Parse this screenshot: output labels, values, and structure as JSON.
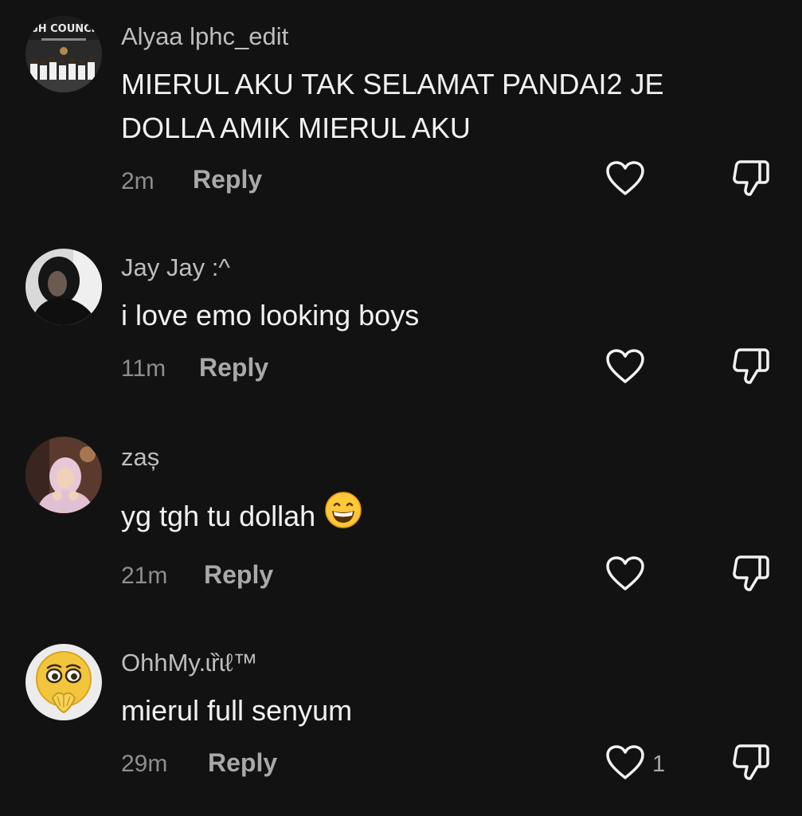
{
  "comments": [
    {
      "username": "Alyaa lphc_edit",
      "avatar_banner": "IGH COUNCIL",
      "text_line1": "MIERUL AKU TAK SELAMAT PANDAI2 JE",
      "text_line2": "DOLLA AMIK MIERUL AKU",
      "time": "2m",
      "reply_label": "Reply",
      "like_icon": "heart-outline-icon",
      "dislike_icon": "thumbs-down-icon"
    },
    {
      "username": "Jay Jay :^",
      "text": "i love emo looking boys",
      "time": "11m",
      "reply_label": "Reply",
      "like_icon": "heart-outline-icon",
      "dislike_icon": "thumbs-down-icon"
    },
    {
      "username": "zaș",
      "text": "yg tgh tu dollah",
      "emoji": "grinning-face-icon",
      "time": "21m",
      "reply_label": "Reply",
      "like_icon": "heart-outline-icon",
      "dislike_icon": "thumbs-down-icon"
    },
    {
      "username": "OhhMy.ɩȑɩℓ™",
      "text": "mierul full senyum",
      "time": "29m",
      "reply_label": "Reply",
      "like_count": "1",
      "like_icon": "heart-outline-icon",
      "dislike_icon": "thumbs-down-icon"
    }
  ],
  "colors": {
    "background": "#121212",
    "username": "#bdbdbd",
    "text": "#f2f2f2",
    "meta": "#8e8e8e",
    "action": "#a9a9a9"
  }
}
